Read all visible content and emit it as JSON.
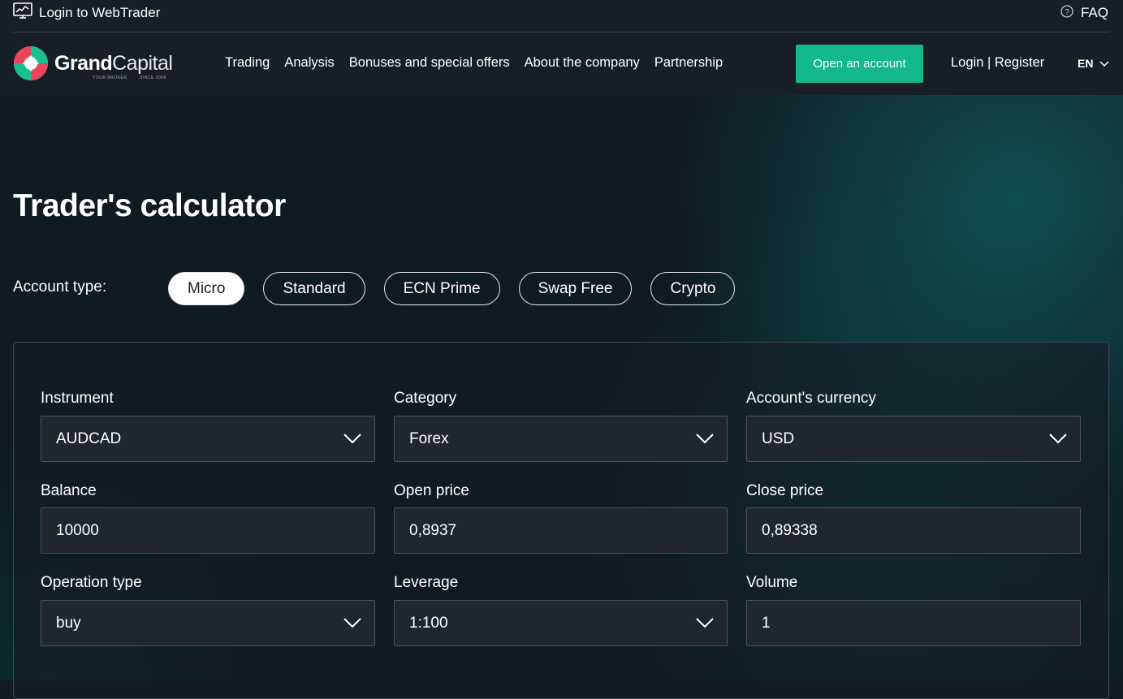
{
  "topbar": {
    "webtrader_label": "Login to WebTrader",
    "faq_label": "FAQ"
  },
  "navbar": {
    "brand_bold": "Grand",
    "brand_regular": "Capital",
    "tagline_left": "YOUR BROKER",
    "tagline_right": "SINCE 2006",
    "links": [
      "Trading",
      "Analysis",
      "Bonuses and special offers",
      "About the company",
      "Partnership"
    ],
    "open_account_label": "Open an account",
    "login_register_label": "Login | Register",
    "language": "EN"
  },
  "page": {
    "title": "Trader's calculator",
    "account_type_label": "Account type:",
    "account_types": [
      "Micro",
      "Standard",
      "ECN Prime",
      "Swap Free",
      "Crypto"
    ],
    "active_account_type": "Micro"
  },
  "calculator": {
    "instrument": {
      "label": "Instrument",
      "value": "AUDCAD"
    },
    "category": {
      "label": "Category",
      "value": "Forex"
    },
    "currency": {
      "label": "Account's currency",
      "value": "USD"
    },
    "balance": {
      "label": "Balance",
      "value": "10000"
    },
    "open_price": {
      "label": "Open price",
      "value": "0,8937"
    },
    "close_price": {
      "label": "Close price",
      "value": "0,89338"
    },
    "operation_type": {
      "label": "Operation type",
      "value": "buy"
    },
    "leverage": {
      "label": "Leverage",
      "value": "1:100"
    },
    "volume": {
      "label": "Volume",
      "value": "1"
    }
  },
  "colors": {
    "accent_green": "#13b98a",
    "logo_red": "#e8465a",
    "logo_green": "#19c08f"
  }
}
